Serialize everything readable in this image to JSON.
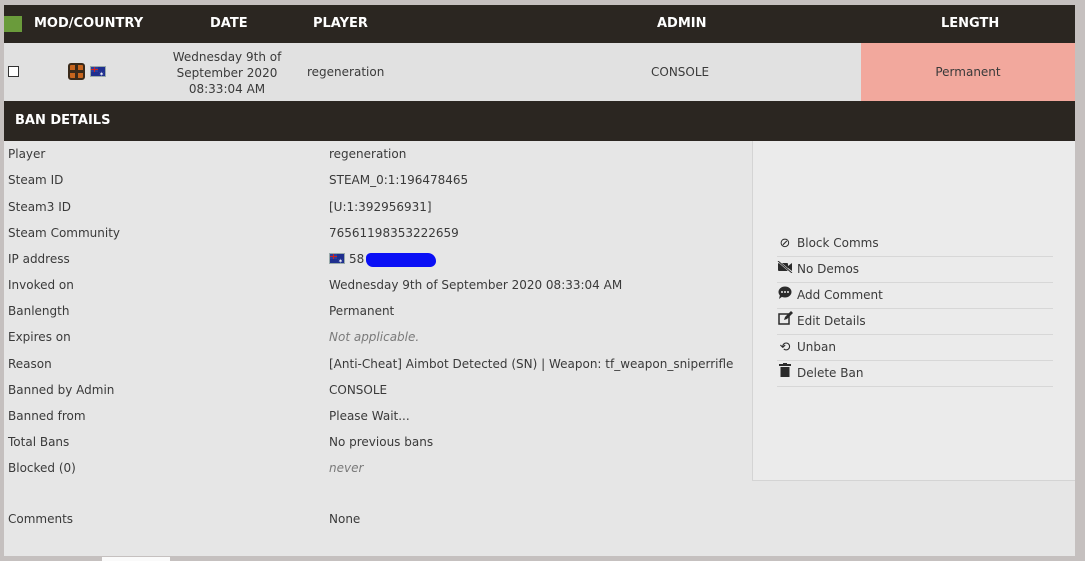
{
  "table_header": {
    "mod_country": "MOD/COUNTRY",
    "date": "DATE",
    "player": "PLAYER",
    "admin": "ADMIN",
    "length": "LENGTH"
  },
  "ban_row": {
    "date_line1": "Wednesday 9th of",
    "date_line2": "September 2020",
    "date_line3": "08:33:04 AM",
    "player": "regeneration",
    "admin": "CONSOLE",
    "length": "Permanent",
    "length_color": "#f2a89d",
    "mod_icon": "tf2-icon",
    "country_icon": "australia-flag-icon"
  },
  "details_header": {
    "title": "BAN DETAILS"
  },
  "details": [
    {
      "label": "Player",
      "value": "regeneration"
    },
    {
      "label": "Steam ID",
      "value": "STEAM_0:1:196478465"
    },
    {
      "label": "Steam3 ID",
      "value": "[U:1:392956931]"
    },
    {
      "label": "Steam Community",
      "value": "76561198353222659"
    },
    {
      "label": "IP address",
      "value": "58"
    },
    {
      "label": "Invoked on",
      "value": "Wednesday 9th of September 2020 08:33:04 AM"
    },
    {
      "label": "Banlength",
      "value": "Permanent"
    },
    {
      "label": "Expires on",
      "value": "Not applicable."
    },
    {
      "label": "Reason",
      "value": "[Anti-Cheat] Aimbot Detected (SN) | Weapon: tf_weapon_sniperrifle"
    },
    {
      "label": "Banned by Admin",
      "value": "CONSOLE"
    },
    {
      "label": "Banned from",
      "value": "Please Wait..."
    },
    {
      "label": "Total Bans",
      "value": "No previous bans"
    },
    {
      "label": "Blocked (0)",
      "value": "never"
    },
    {
      "label": "Comments",
      "value": "None"
    }
  ],
  "actions": [
    {
      "label": "Block Comms",
      "icon": "block-icon"
    },
    {
      "label": "No Demos",
      "icon": "no-video-icon"
    },
    {
      "label": "Add Comment",
      "icon": "comment-icon"
    },
    {
      "label": "Edit Details",
      "icon": "edit-icon"
    },
    {
      "label": "Unban",
      "icon": "undo-icon"
    },
    {
      "label": "Delete Ban",
      "icon": "trash-icon"
    }
  ],
  "colors": {
    "header_bg": "#2b2621",
    "accent_green": "#6a9b3b",
    "redaction": "#0a0ff5"
  }
}
